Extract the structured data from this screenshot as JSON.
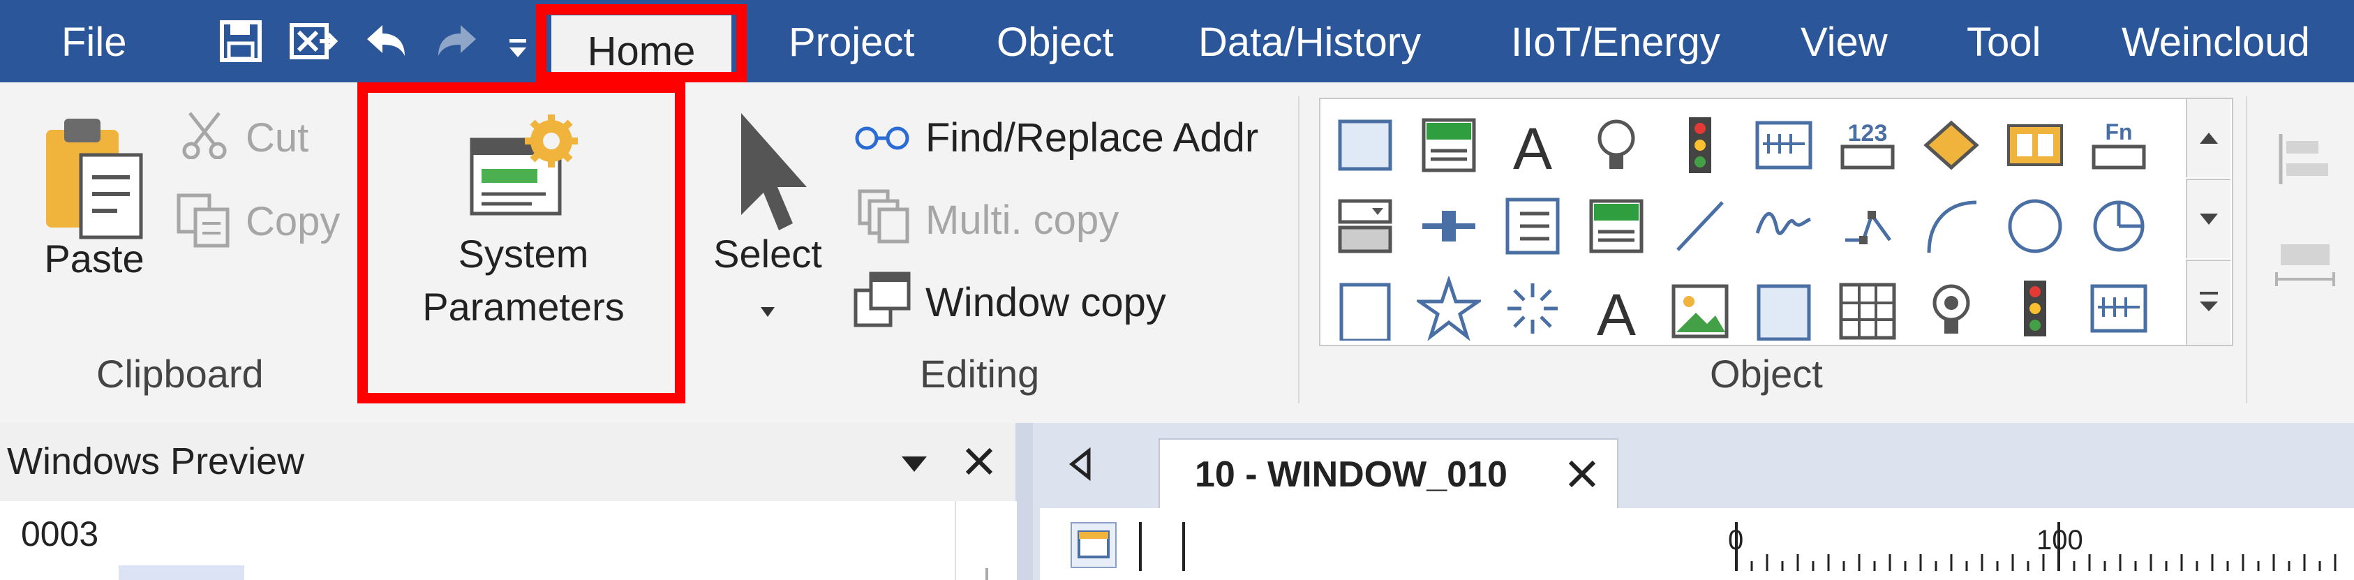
{
  "menu": {
    "file": "File",
    "tabs": [
      "Home",
      "Project",
      "Object",
      "Data/History",
      "IIoT/Energy",
      "View",
      "Tool",
      "Weincloud"
    ],
    "active_tab": "Home"
  },
  "quick_access": {
    "icons": [
      "save-icon",
      "exit-icon",
      "undo-icon",
      "redo-icon",
      "customize-dropdown-icon"
    ]
  },
  "ribbon": {
    "clipboard": {
      "group_label": "Clipboard",
      "paste": "Paste",
      "cut": "Cut",
      "copy": "Copy"
    },
    "system_parameters": {
      "line1": "System",
      "line2": "Parameters"
    },
    "editing": {
      "group_label": "Editing",
      "select": "Select",
      "find_replace": "Find/Replace Addr",
      "multi_copy": "Multi. copy",
      "window_copy": "Window copy"
    },
    "object": {
      "group_label": "Object",
      "gallery_icons": [
        [
          "bit-lamp-icon",
          "numeric-999-icon",
          "text-icon",
          "bulb-icon",
          "traffic-light-icon",
          "historic-trend-icon",
          "numeric-123-icon",
          "tag-icon",
          "toggle-icon",
          "function-key-icon"
        ],
        [
          "combo-button-icon",
          "slider-icon",
          "list-icon",
          "abc-display-icon",
          "line-icon",
          "wave-icon",
          "polyline-icon",
          "arc-icon",
          "circle-icon",
          "pie-icon"
        ],
        [
          "rectangle-icon",
          "star-icon",
          "burst-icon",
          "text-a-icon",
          "picture-icon",
          "frame-icon",
          "table-icon",
          "bulb-2-icon",
          "traffic-light-2-icon",
          "trend-2-icon"
        ]
      ]
    },
    "highlight_colors": {
      "box": "#ff0000"
    }
  },
  "windows_preview": {
    "title": "Windows Preview",
    "item": "0003"
  },
  "document": {
    "tab_label": "10 - WINDOW_010",
    "ruler_zero": "0",
    "ruler_hundred": "100"
  },
  "colors": {
    "menubar": "#2b579a",
    "ribbon": "#f3f3f3",
    "highlight": "#ff0000"
  }
}
